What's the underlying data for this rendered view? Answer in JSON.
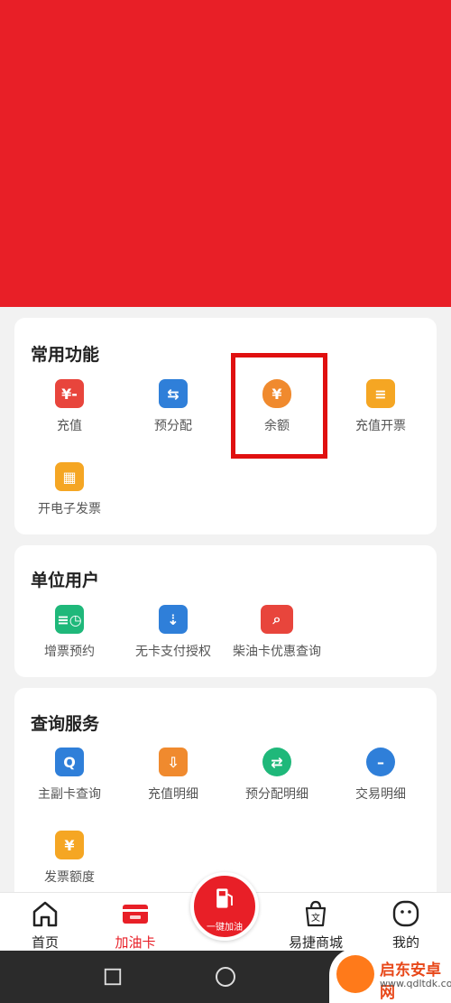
{
  "sections": {
    "common": {
      "title": "常用功能",
      "items": [
        {
          "label": "充值",
          "icon": "yuan-card-icon",
          "color": "#e8453c"
        },
        {
          "label": "预分配",
          "icon": "transfer-icon",
          "color": "#2f7fd9"
        },
        {
          "label": "余额",
          "icon": "money-bag-icon",
          "color": "#f08a2e"
        },
        {
          "label": "充值开票",
          "icon": "invoice-arrow-icon",
          "color": "#f5a623"
        },
        {
          "label": "开电子发票",
          "icon": "e-invoice-icon",
          "color": "#f5a623"
        }
      ]
    },
    "unit": {
      "title": "单位用户",
      "items": [
        {
          "label": "增票预约",
          "icon": "clock-ticket-icon",
          "color": "#1fb87a"
        },
        {
          "label": "无卡支付授权",
          "icon": "user-authorize-icon",
          "color": "#2f7fd9"
        },
        {
          "label": "柴油卡优惠查询",
          "icon": "ticket-search-icon",
          "color": "#e8453c"
        }
      ]
    },
    "query": {
      "title": "查询服务",
      "items": [
        {
          "label": "主副卡查询",
          "icon": "card-search-icon",
          "color": "#2f7fd9"
        },
        {
          "label": "充值明细",
          "icon": "download-box-icon",
          "color": "#f08a2e"
        },
        {
          "label": "预分配明细",
          "icon": "exchange-search-icon",
          "color": "#1fb87a"
        },
        {
          "label": "交易明细",
          "icon": "transaction-icon",
          "color": "#2f7fd9"
        },
        {
          "label": "发票额度",
          "icon": "invoice-yuan-icon",
          "color": "#f5a623"
        }
      ]
    }
  },
  "tabbar": {
    "home": "首页",
    "card": "加油卡",
    "fuel": "一键加油",
    "mall": "易捷商城",
    "me": "我的"
  },
  "watermark": {
    "name": "启东安卓网",
    "url": "www.qdltdk.com"
  },
  "colors": {
    "brand_red": "#e81f27",
    "highlight": "#e01010"
  }
}
